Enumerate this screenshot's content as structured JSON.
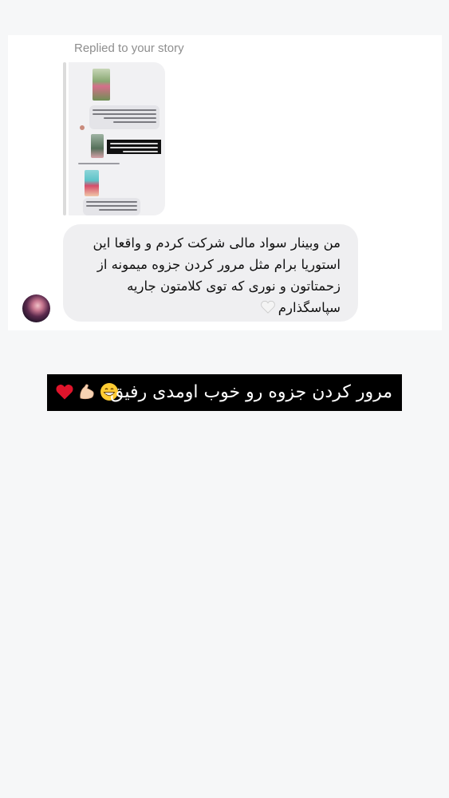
{
  "reply_header": {
    "label": "Replied to your story"
  },
  "story_preview": {
    "mini_label": "Replied to your story"
  },
  "message": {
    "text": "من وبینار سواد مالی شرکت کردم و واقعا این\nاستوریا برام مثل مرور کردن جزوه میمونه از\nزحمتاتون و نوری که توی کلامتون جاریه\nسپاسگذارم",
    "trailing_emoji": "white-heart-icon"
  },
  "caption": {
    "text": "مرور کردن جزوه رو خوب اومدی رفیق",
    "emojis": [
      "grinning-face-icon",
      "flexed-biceps-icon",
      "red-heart-icon"
    ]
  },
  "colors": {
    "background": "#f6f7f8",
    "card": "#ffffff",
    "bubble": "#efeff1",
    "caption_bg": "#000000",
    "caption_text": "#ffffff",
    "meta_text": "#8e8e8e"
  }
}
